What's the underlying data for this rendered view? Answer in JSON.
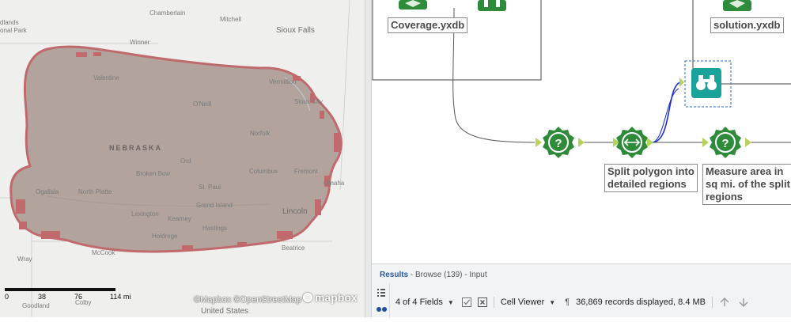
{
  "map": {
    "places": {
      "chamberlain": "Chamberlain",
      "mitchell": "Mitchell",
      "badlands": "dlands",
      "park": "onal Park",
      "winner": "Winner",
      "sioux_falls": "Sioux Falls",
      "valentine": "Valentine",
      "vermillion": "Vermillion",
      "sioux_city": "Sioux City",
      "oneill": "O'Neill",
      "norfolk": "Norfolk",
      "nebraska": "NEBRASKA",
      "broken_bow": "Broken Bow",
      "ord": "Ord",
      "columbus": "Columbus",
      "fremont": "Fremont",
      "omaha": "Omaha",
      "ogallala": "Ogallala",
      "north_platte": "North Platte",
      "st_paul": "St. Paul",
      "grand_island": "Grand Island",
      "lincoln": "Lincoln",
      "lexington": "Lexington",
      "kearney": "Kearney",
      "hastings": "Hastings",
      "holdrege": "Holdrege",
      "mccook": "McCook",
      "beatrice": "Beatrice",
      "wray": "Wray",
      "colby": "Colby",
      "united_states": "United States",
      "goodland": "Goodland"
    },
    "scale": {
      "t0": "0",
      "t1": "38",
      "t2": "76",
      "t3": "114 mi"
    },
    "attribution": "©Mapbox ©OpenStreetMap",
    "logo": "mapbox",
    "colors": {
      "buffer_fill": "#b2a49c",
      "buffer_outline": "#c06a6e",
      "background": "#efefed"
    }
  },
  "workflow": {
    "labels": {
      "coverage": "Coverage.yxdb",
      "solution": "solution.yxdb",
      "split": "Split polygon into\ndetailed regions",
      "measure": "Measure area in\nsq mi. of the split\nregions"
    },
    "colors": {
      "tool_green": "#2e8b3a",
      "browse_teal": "#1aa39b",
      "anchor": "#b6d35a",
      "selected_line": "#1b2fc9"
    }
  },
  "results": {
    "title": "Results",
    "crumb": " - Browse (139) - Input",
    "fields": "4 of 4 Fields",
    "viewer": "Cell Viewer",
    "records": "36,869 records displayed, 8.4 MB"
  }
}
